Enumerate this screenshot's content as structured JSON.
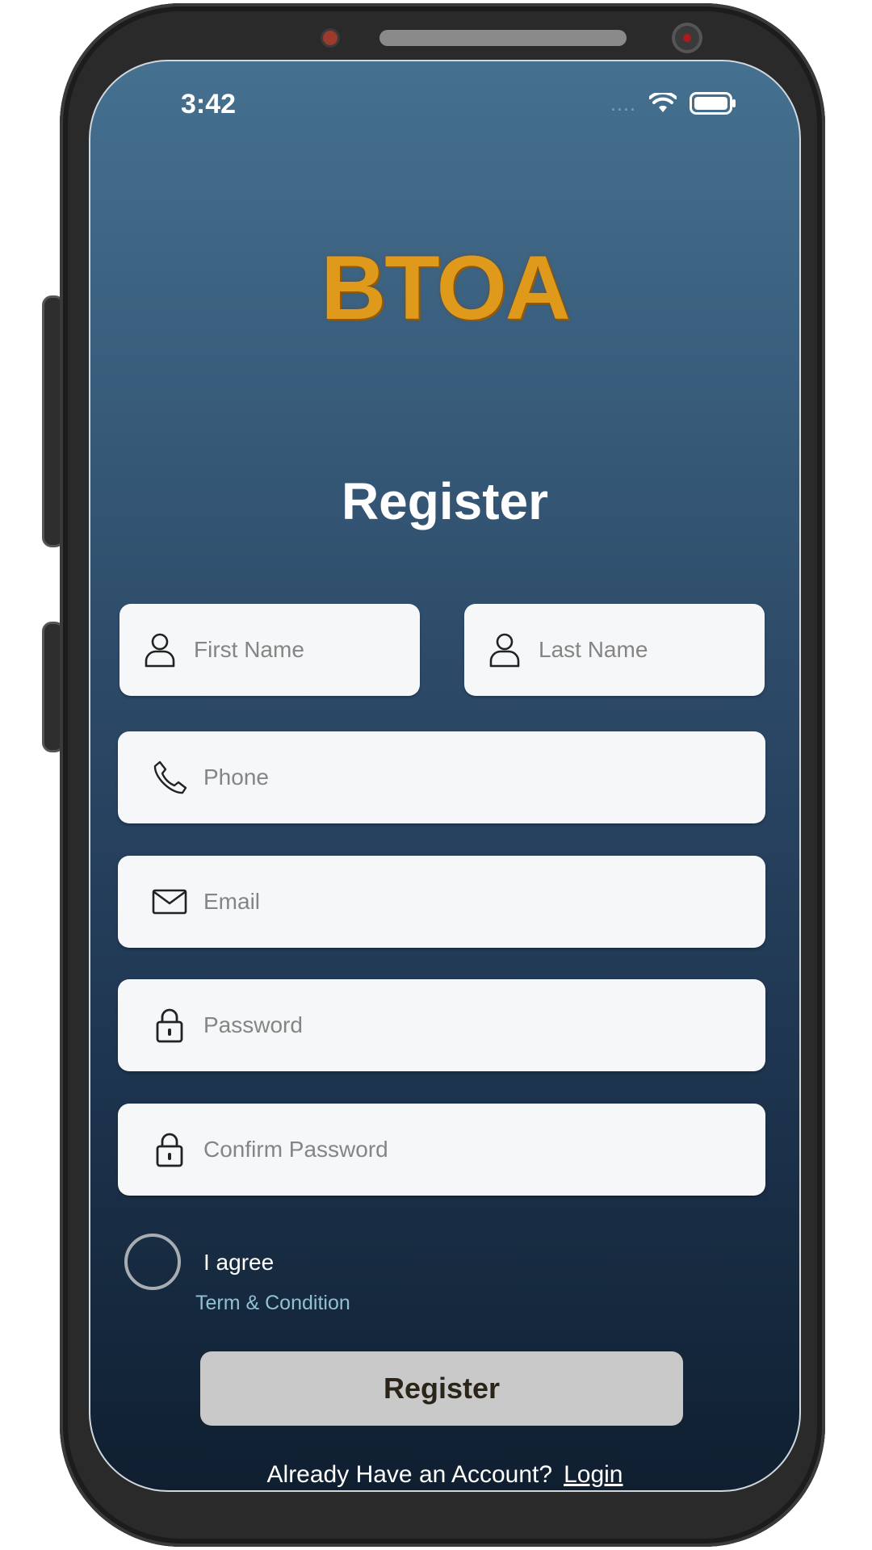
{
  "status_bar": {
    "time": "3:42",
    "signal": "....",
    "icons": [
      "wifi-icon",
      "battery-icon"
    ]
  },
  "logo": {
    "text": "BTOA",
    "color": "#e09a1b"
  },
  "page": {
    "title": "Register"
  },
  "form": {
    "first_name": {
      "placeholder": "First Name",
      "icon": "user-icon"
    },
    "last_name": {
      "placeholder": "Last Name",
      "icon": "user-icon"
    },
    "phone": {
      "placeholder": "Phone",
      "icon": "phone-icon"
    },
    "email": {
      "placeholder": "Email",
      "icon": "mail-icon"
    },
    "password": {
      "placeholder": "Password",
      "icon": "lock-icon"
    },
    "confirm_password": {
      "placeholder": "Confirm Password",
      "icon": "lock-icon"
    }
  },
  "agreement": {
    "label": "I agree",
    "terms_link": "Term & Condition",
    "checked": false
  },
  "register_button": {
    "label": "Register"
  },
  "footer": {
    "prompt": "Already Have an Account?",
    "login_link": "Login"
  },
  "colors": {
    "background_top": "#45708f",
    "background_bottom": "#0f1f30",
    "field_background": "#f5f7f8",
    "button_background": "#c9c9c9",
    "terms_link": "#8fc1d1"
  }
}
